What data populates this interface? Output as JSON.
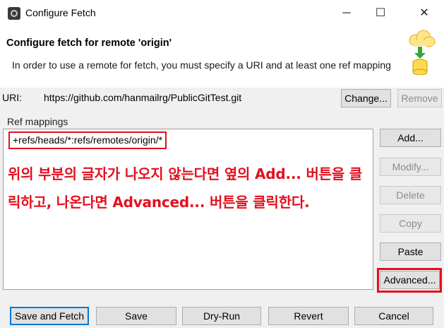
{
  "window": {
    "title": "Configure Fetch",
    "controls": {
      "minimize": "─",
      "maximize": "☐",
      "close": "✕"
    }
  },
  "header": {
    "title": "Configure fetch for remote 'origin'",
    "message": "In order to use a remote for fetch, you must specify a URI and at least one ref mapping",
    "graphic_icon": "cloud-fetch-database-icon"
  },
  "uri": {
    "label": "URI:",
    "value": "https://github.com/hanmailrg/PublicGitTest.git",
    "change_label": "Change...",
    "remove_label": "Remove"
  },
  "ref_mappings": {
    "label": "Ref mappings",
    "entries": [
      "+refs/heads/*:refs/remotes/origin/*"
    ],
    "annotation": "위의 부분의 글자가 나오지 않는다면 옆의 Add... 버튼을 클릭하고, 나온다면 Advanced... 버튼을 클릭한다."
  },
  "side_buttons": {
    "add": "Add...",
    "modify": "Modify...",
    "delete": "Delete",
    "copy": "Copy",
    "paste": "Paste",
    "advanced": "Advanced..."
  },
  "footer": {
    "save_and_fetch": "Save and Fetch",
    "save": "Save",
    "dry_run": "Dry-Run",
    "revert": "Revert",
    "cancel": "Cancel"
  },
  "colors": {
    "highlight": "#e3101e",
    "focus": "#0078d7",
    "panel": "#f0f0f0"
  }
}
